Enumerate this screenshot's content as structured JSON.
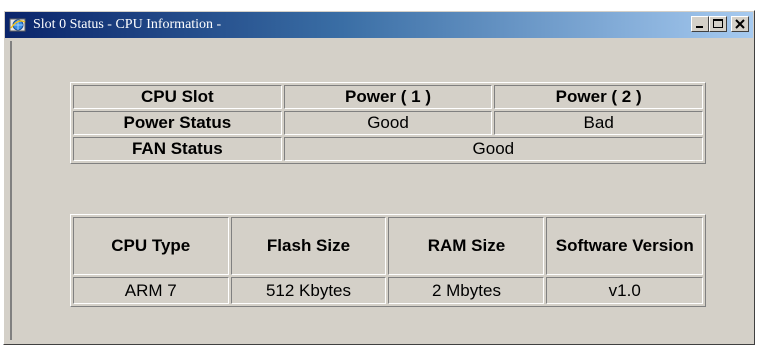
{
  "window": {
    "title": "Slot 0 Status - CPU Information -",
    "icon": "browser-globe-icon",
    "controls": [
      "minimize-icon",
      "maximize-icon",
      "close-icon"
    ]
  },
  "status_table": {
    "col_headers": [
      "CPU Slot",
      "Power ( 1 )",
      "Power ( 2 )"
    ],
    "rows": [
      {
        "label": "Power Status",
        "values": [
          "Good",
          "Bad"
        ]
      },
      {
        "label": "FAN Status",
        "value": "Good"
      }
    ]
  },
  "info_table": {
    "headers": [
      "CPU Type",
      "Flash Size",
      "RAM Size",
      "Software Version"
    ],
    "values": [
      "ARM 7",
      "512 Kbytes",
      "2 Mbytes",
      "v1.0"
    ]
  },
  "colors": {
    "bad_text": "#e02020",
    "face": "#d4d0c8",
    "title_start": "#0a246a",
    "title_end": "#a6caf0"
  }
}
